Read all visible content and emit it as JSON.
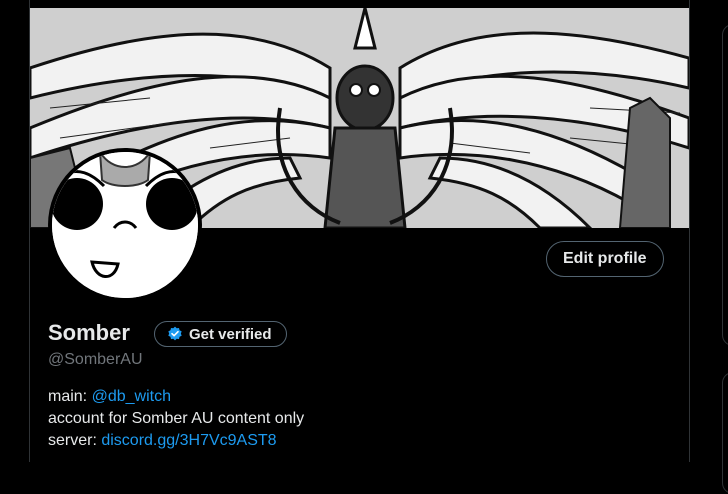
{
  "profile": {
    "display_name": "Somber",
    "handle": "@SomberAU",
    "get_verified_label": "Get verified",
    "edit_profile_label": "Edit profile",
    "bio": {
      "line1_prefix": "main: ",
      "line1_link": "@db_witch",
      "line2": "account for Somber AU content only",
      "line3_prefix": "server: ",
      "line3_link": "discord.gg/3H7Vc9AST8"
    }
  },
  "colors": {
    "background": "#000000",
    "accent": "#1d9bf0",
    "muted_text": "#71767b",
    "border": "#536471"
  },
  "icons": {
    "verified_badge": "verified-badge-icon"
  }
}
